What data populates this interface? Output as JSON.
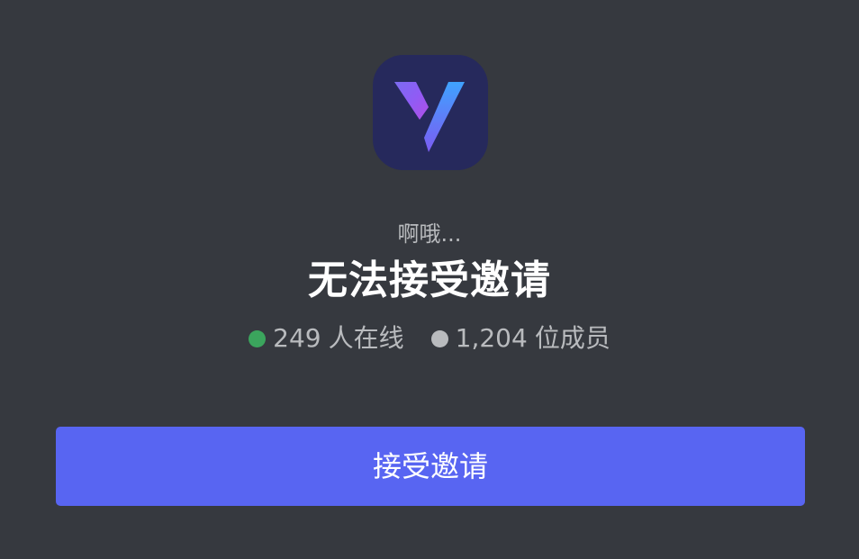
{
  "invite": {
    "subtitle": "啊哦...",
    "title": "无法接受邀请",
    "online": {
      "count": "249",
      "label": "人在线"
    },
    "members": {
      "count": "1,204",
      "label": "位成员"
    },
    "accept_label": "接受邀请",
    "server_icon": "v-logo-icon"
  },
  "colors": {
    "background": "#36393f",
    "button": "#5865f2",
    "online_dot": "#3ba55d",
    "member_dot": "#b9bbbe",
    "icon_bg": "#26295c"
  }
}
